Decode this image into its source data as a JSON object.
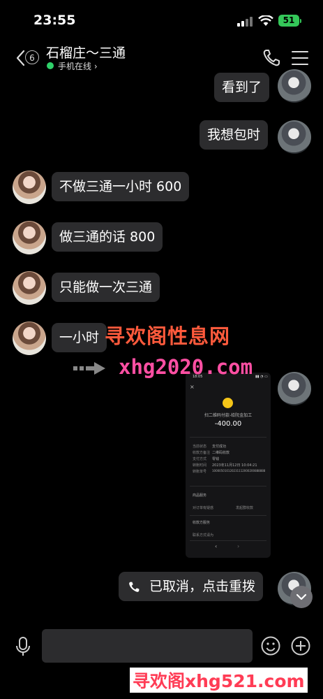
{
  "status": {
    "time": "23:55",
    "battery": "51"
  },
  "header": {
    "unread_count": "6",
    "title": "石榴庄～三通",
    "online": "手机在线"
  },
  "messages": [
    {
      "side": "right",
      "text": "看到了"
    },
    {
      "side": "right",
      "text": "我想包时"
    },
    {
      "side": "left",
      "text": "不做三通一小时 600"
    },
    {
      "side": "left",
      "text": "做三通的话 800"
    },
    {
      "side": "left",
      "text": "只能做一次三通"
    },
    {
      "side": "left",
      "text": "一小时"
    },
    {
      "side": "right",
      "text": "已取消，点击重拨"
    }
  ],
  "receipt": {
    "time": "18:05",
    "merchant": "扫二维码付款-给阮金加工",
    "amount": "-400.00",
    "rows": [
      [
        "当前状态",
        "支付成功"
      ],
      [
        "收款方备注",
        "二维码收款"
      ],
      [
        "支付方式",
        "零钱"
      ],
      [
        "转账时间",
        "2023年11月12日 10:04:21"
      ],
      [
        "转账单号",
        "100005010120231112000200888888"
      ]
    ],
    "service_title": "商品服务",
    "link1": "对订单有疑惑",
    "link2": "发起群收款",
    "merchant_service": "收款方服务",
    "contact": "联系方式请为"
  },
  "watermark": {
    "line1": "寻欢阁性息网",
    "line2": "xhg2020.com",
    "line3": "寻欢阁xhg521.com"
  },
  "colors": {
    "online": "#2fd16a",
    "battery": "#34c759",
    "bubble": "#2c2c2e"
  }
}
